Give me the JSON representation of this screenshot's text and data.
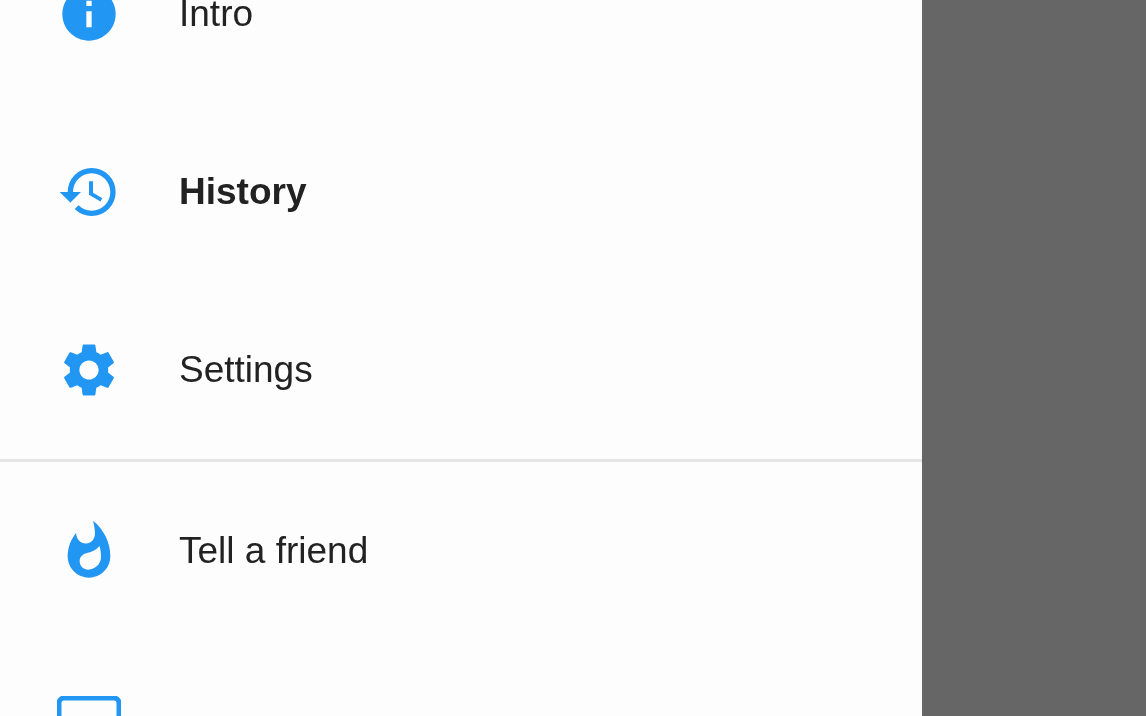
{
  "drawer": {
    "sections": [
      {
        "items": [
          {
            "kind": "info",
            "label": "Intro",
            "selected": false
          },
          {
            "kind": "history",
            "label": "History",
            "selected": true
          },
          {
            "kind": "settings",
            "label": "Settings",
            "selected": false
          }
        ]
      },
      {
        "items": [
          {
            "kind": "flame",
            "label": "Tell a friend",
            "selected": false
          },
          {
            "kind": "screen"
          }
        ]
      }
    ]
  }
}
